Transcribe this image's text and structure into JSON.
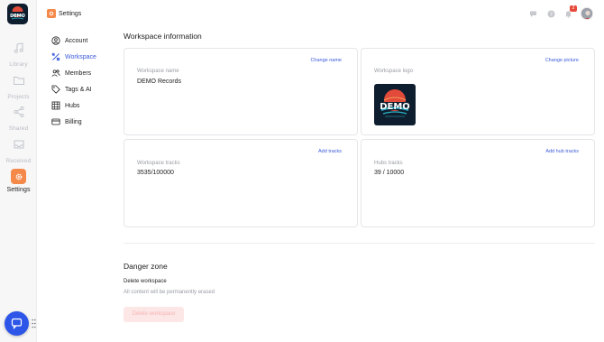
{
  "app": {
    "logo_text": "DEMO"
  },
  "rail": {
    "items": [
      {
        "label": "Library",
        "icon": "music-note-icon"
      },
      {
        "label": "Projects",
        "icon": "folder-icon"
      },
      {
        "label": "Shared",
        "icon": "share-icon"
      },
      {
        "label": "Received",
        "icon": "inbox-icon"
      },
      {
        "label": "Settings",
        "icon": "gear-icon",
        "active": true
      }
    ]
  },
  "topbar": {
    "breadcrumb": "Settings",
    "notification_count": "2"
  },
  "settings_nav": {
    "items": [
      {
        "label": "Account",
        "icon": "user-circle-icon"
      },
      {
        "label": "Workspace",
        "icon": "tools-icon",
        "active": true
      },
      {
        "label": "Members",
        "icon": "users-icon"
      },
      {
        "label": "Tags & AI",
        "icon": "tag-icon"
      },
      {
        "label": "Hubs",
        "icon": "hub-icon"
      },
      {
        "label": "Billing",
        "icon": "credit-card-icon"
      }
    ]
  },
  "workspace": {
    "title": "Workspace information",
    "name_card": {
      "label": "Workspace name",
      "value": "DEMO Records",
      "action": "Change name"
    },
    "logo_card": {
      "label": "Workspace logo",
      "action": "Change picture"
    },
    "tracks_card": {
      "label": "Workspace tracks",
      "value": "3535/100000",
      "action": "Add tracks"
    },
    "hubs_card": {
      "label": "Hubs tracks",
      "value": "39 / 10000",
      "action": "Add hub tracks"
    }
  },
  "danger": {
    "title": "Danger zone",
    "delete_label": "Delete workspace",
    "delete_desc": "All content will be permanently erased",
    "delete_button": "Delete workspace"
  },
  "colors": {
    "accent": "#3b5bdb",
    "settings_orange": "#f5894a",
    "danger_bg": "#fde6e6",
    "danger_text": "#f6b5b5"
  }
}
